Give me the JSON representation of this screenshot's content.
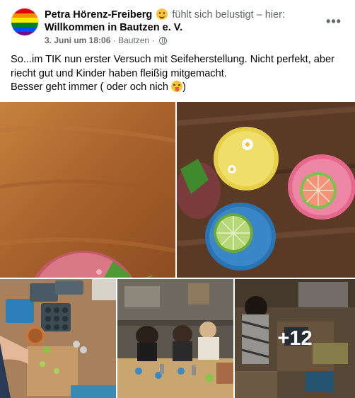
{
  "post": {
    "author": "Petra Hörenz-Freiberg",
    "feeling_text": "fühlt sich belustigt – hier:",
    "feeling_emoji": "slightly-smiling-face-icon",
    "place": "Willkommen in Bautzen e. V.",
    "date": "3. Juni um 18:06",
    "location": "Bautzen",
    "separator": "·",
    "privacy_icon": "globe-icon",
    "more_options": "•••",
    "text_lines": [
      "So...im TIK nun erster Versuch mit Seifeherstellung. Nicht perfekt, aber",
      "riecht gut und Kinder haben fleißig mitgemacht.",
      "Besser geht immer ( oder och nich "
    ],
    "text_end": ")",
    "closing_emoji": "winking-face-with-tongue-icon"
  },
  "photos": {
    "extra_count": "+12"
  },
  "colors": {
    "text_primary": "#050505",
    "text_secondary": "#65676b",
    "avatar_stripes": [
      "#e40303",
      "#ff8c00",
      "#ffed00",
      "#008026",
      "#004dff",
      "#750787"
    ]
  }
}
